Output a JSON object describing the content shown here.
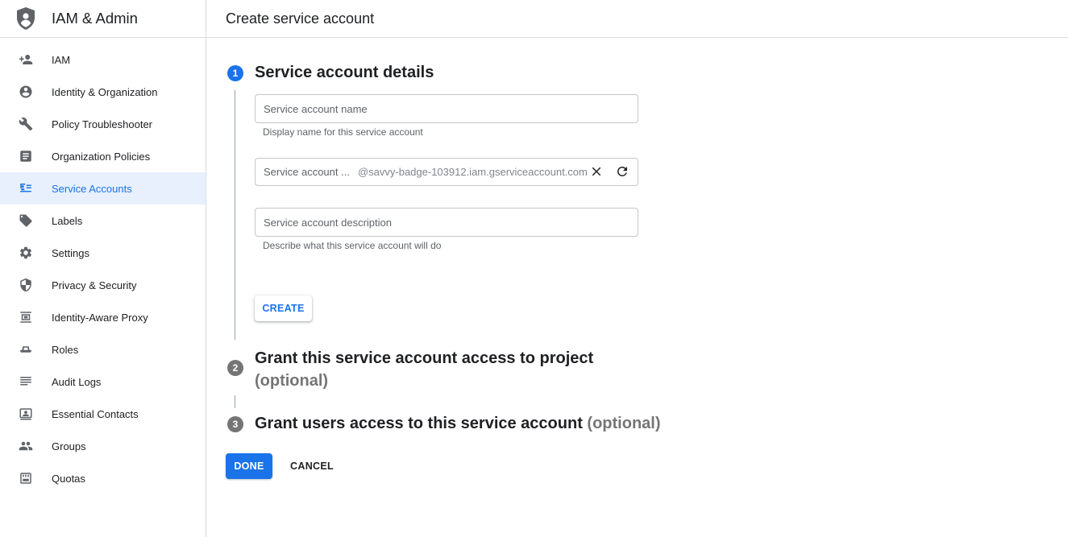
{
  "app": {
    "title": "IAM & Admin"
  },
  "header": {
    "title": "Create service account"
  },
  "sidebar": {
    "items": [
      {
        "label": "IAM",
        "icon": "person-add-icon"
      },
      {
        "label": "Identity & Organization",
        "icon": "account-circle-icon"
      },
      {
        "label": "Policy Troubleshooter",
        "icon": "wrench-icon"
      },
      {
        "label": "Organization Policies",
        "icon": "document-icon"
      },
      {
        "label": "Service Accounts",
        "icon": "service-account-icon",
        "active": true
      },
      {
        "label": "Labels",
        "icon": "label-icon"
      },
      {
        "label": "Settings",
        "icon": "gear-icon"
      },
      {
        "label": "Privacy & Security",
        "icon": "shield-icon"
      },
      {
        "label": "Identity-Aware Proxy",
        "icon": "proxy-icon"
      },
      {
        "label": "Roles",
        "icon": "roles-icon"
      },
      {
        "label": "Audit Logs",
        "icon": "list-icon"
      },
      {
        "label": "Essential Contacts",
        "icon": "contacts-icon"
      },
      {
        "label": "Groups",
        "icon": "group-icon"
      },
      {
        "label": "Quotas",
        "icon": "quota-icon"
      }
    ]
  },
  "steps": [
    {
      "number": "1",
      "title": "Service account details",
      "optional": ""
    },
    {
      "number": "2",
      "title": "Grant this service account access to project",
      "optional": "(optional)"
    },
    {
      "number": "3",
      "title": "Grant users access to this service account",
      "optional": "(optional)"
    }
  ],
  "form": {
    "name": {
      "placeholder": "Service account name",
      "value": "",
      "hint": "Display name for this service account"
    },
    "id": {
      "placeholder": "Service account ...",
      "value": "",
      "suffix": "@savvy-badge-103912.iam.gserviceaccount.com"
    },
    "description": {
      "placeholder": "Service account description",
      "value": "",
      "hint": "Describe what this service account will do"
    }
  },
  "buttons": {
    "create": "CREATE",
    "done": "DONE",
    "cancel": "CANCEL"
  },
  "colors": {
    "accent": "#1a73e8",
    "active_bg": "#e8f0fe",
    "step_inactive": "#757575"
  }
}
